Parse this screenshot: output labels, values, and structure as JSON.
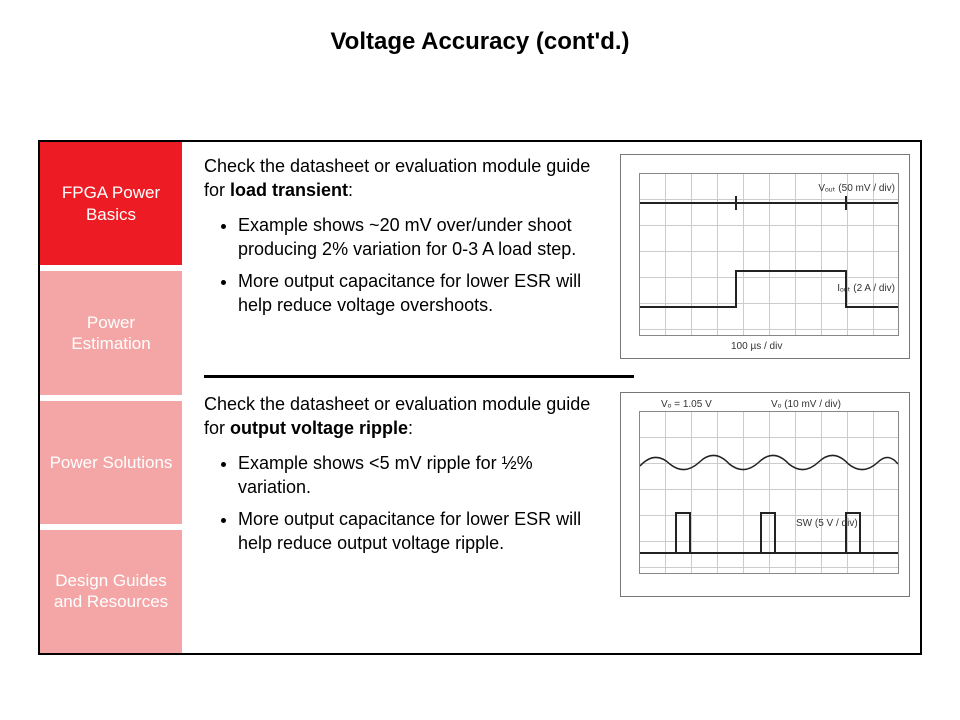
{
  "title": "Voltage Accuracy (cont'd.)",
  "sidebar": {
    "items": [
      {
        "label": "FPGA Power Basics",
        "active": true
      },
      {
        "label": "Power Estimation",
        "active": false
      },
      {
        "label": "Power Solutions",
        "active": false
      },
      {
        "label": "Design Guides and Resources",
        "active": false
      }
    ]
  },
  "section1": {
    "intro_prefix": "Check the datasheet or evaluation module guide for ",
    "intro_bold": "load transient",
    "intro_suffix": ":",
    "bullets": [
      "Example shows ~20 mV over/under shoot producing 2% variation for 0-3 A load step.",
      "More output capacitance for lower ESR will help reduce voltage overshoots."
    ],
    "scope": {
      "vout_label": "Vₒᵤₜ (50 mV / div)",
      "iout_label": "Iₒᵤₜ (2 A / div)",
      "timebase": "100 µs / div"
    }
  },
  "section2": {
    "intro_prefix": "Check the datasheet or evaluation module guide for ",
    "intro_bold": "output voltage ripple",
    "intro_suffix": ":",
    "bullets": [
      "Example shows <5 mV ripple for ½% variation.",
      "More output capacitance for lower ESR will help reduce output voltage ripple."
    ],
    "scope": {
      "vo_set": "Vₒ = 1.05 V",
      "vo_label": "Vₒ (10 mV / div)",
      "sw_label": "SW (5 V / div)"
    }
  }
}
